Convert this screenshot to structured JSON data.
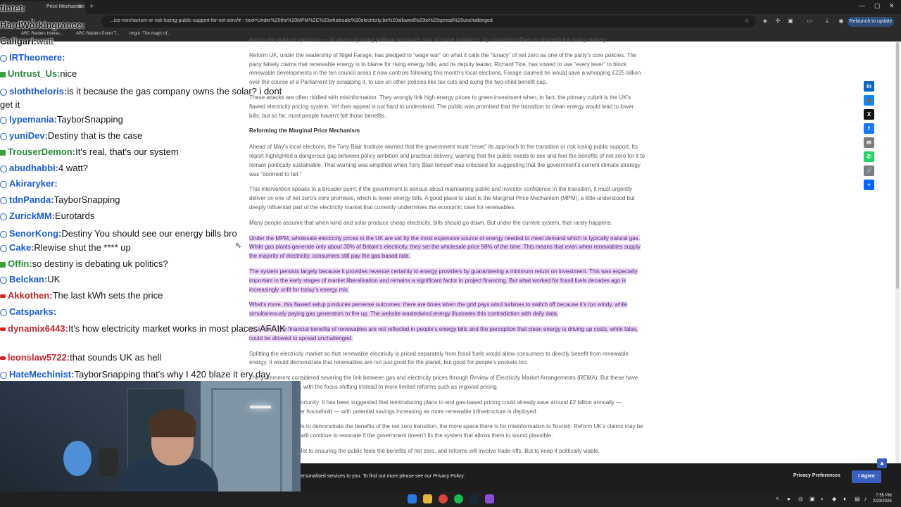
{
  "browser": {
    "tab_title": "Price Mechanism",
    "url": "...ice-mechanism-or-risk-losing-public-support-for-net-zero/#:~:text=Under%20the%20MPM%2C%20wholesale%20electricity,be%20allowed%20to%20spread%20unchallenged",
    "relaunch_label": "Relaunch to update",
    "bookmarks": [
      "ARC Raiders Interac...",
      "ARC Raiders Event T...",
      "Imgur: The magic of..."
    ]
  },
  "article": {
    "paragraphs_top": [
      "across the political spectrum — all driven by rising political pressures and, in some instances, by concerted efforts to discredit the policy entirely.",
      "Reform UK, under the leadership of Nigel Farage, has pledged to “wage war” on what it calls the “lunacy” of net zero as one of the party’s core policies. The party falsely claims that renewable energy is to blame for rising energy bills, and its deputy leader, Richard Tice, has vowed to use “every lever” to block renewable developments in the ten council areas it now controls following this month’s local elections. Farage claimed he would save a whopping £225 billion over the course of a Parliament by scrapping it, to use on other policies like tax cuts and axing the two-child benefit cap.",
      "These attacks are often riddled with misinformation. They wrongly link high energy prices to green investment when, in fact, the primary culprit is the UK’s flawed electricity pricing system. Yet their appeal is not hard to understand. The public was promised that the transition to clean energy would lead to lower bills, but so far, most people haven’t felt those benefits."
    ],
    "heading": "Reforming the Marginal Price Mechanism",
    "paragraphs_mid": [
      "Ahead of May’s local elections, the Tony Blair Institute warned that the government must “reset” its approach to the transition or risk losing public support. Its report highlighted a dangerous gap between policy ambition and practical delivery, warning that the public needs to see and feel the benefits of net zero for it to remain politically sustainable. That warning was amplified when Tony Blair himself was criticised for suggesting that the government’s current climate strategy was “doomed to fail.”",
      "This intervention speaks to a broader point: if the government is serious about maintaining public and investor confidence in the transition, it must urgently deliver on one of net zero’s core promises, which is lower energy bills. A good place to start is the Marginal Price Mechanism (MPM), a little-understood but deeply influential part of the electricity market that currently undermines the economic case for renewables.",
      "Many people assume that when wind and solar produce cheap electricity, bills should go down. But under the current system, that rarely happens."
    ],
    "highlighted": [
      "Under the MPM, wholesale electricity prices in the UK are set by the most expensive source of energy needed to meet demand which is typically natural gas. While gas plants generate only about 30% of Britain’s electricity, they set the wholesale price 98% of the time. This means that even when renewables supply the majority of electricity, consumers still pay the gas-based rate.",
      "The system persists largely because it provides revenue certainty to energy providers by guaranteeing a minimum return on investment. This was especially important in the early stages of market liberalisation and remains a significant factor in project financing. But what worked for fossil fuels decades ago is increasingly unfit for today’s energy mix.",
      "What’s more, this flawed setup produces perverse outcomes: there are times when the grid pays wind turbines to switch off because it’s too windy, while simultaneously paying gas generators to fire up. The website wastedwind.energy illustrates this contradiction with daily data.",
      "As a result, the financial benefits of renewables are not reflected in people’s energy bills and the perception that clean energy is driving up costs, while false, could be allowed to spread unchallenged."
    ],
    "paragraphs_bottom": [
      "Splitting the electricity market so that renewable electricity is priced separately from fossil fuels would allow consumers to directly benefit from renewable energy. It would demonstrate that renewables are not just good for the planet, but good for people’s pockets too.",
      "The government considered severing the link between gas and electricity prices through Review of Electricity Market Arrangements (REMA). But these have since been sidelined, with the focus shifting instead to more limited reforms such as regional pricing.",
      "This is a missed opportunity. It has been suggested that reintroducing plans to end gas-based pricing could already save around £2 billion annually — approximately £23 per household — with potential savings increasing as more renewable infrastructure is deployed.",
      "If the government fails to demonstrate the benefits of the net zero transition, the more space there is for misinformation to flourish. Reform UK’s claims may be misleading, but they will continue to resonate if the government doesn’t fix the system that allows them to sound plausible.",
      "There is no silver bullet to ensuring the public feels the benefits of net zero, and reforms will involve trade-offs. But to keep it politically viable,"
    ]
  },
  "share_buttons": [
    {
      "icon": "linkedin-icon",
      "glyph": "in",
      "color": "#0a66c2"
    },
    {
      "icon": "bluesky-icon",
      "glyph": "🦋",
      "color": "#1185fe"
    },
    {
      "icon": "x-icon",
      "glyph": "X",
      "color": "#111111"
    },
    {
      "icon": "facebook-icon",
      "glyph": "f",
      "color": "#1877f2"
    },
    {
      "icon": "email-icon",
      "glyph": "✉",
      "color": "#7c7c7c"
    },
    {
      "icon": "whatsapp-icon",
      "glyph": "✆",
      "color": "#25d366"
    },
    {
      "icon": "copy-link-icon",
      "glyph": "🔗",
      "color": "#7c7c7c"
    },
    {
      "icon": "share-plus-icon",
      "glyph": "+",
      "color": "#0166ff"
    }
  ],
  "chat": [
    {
      "user": "tintet:",
      "text": "",
      "badge": "none"
    },
    {
      "user": "HardWorkingrance:",
      "text": "",
      "badge": "none"
    },
    {
      "user": "Caligari:",
      "text": "watt",
      "badge": "none"
    },
    {
      "user": "IRTheomere:",
      "text": "",
      "badge": "b"
    },
    {
      "user": "Untrust_Us:",
      "text": "nice",
      "badge": "k"
    },
    {
      "user": "sloththeloris:",
      "text": "is it because the gas company owns the solar? i dont get it",
      "badge": "b"
    },
    {
      "user": "lypemania:",
      "text": "TayborSnapping",
      "badge": "b"
    },
    {
      "user": "yuniDev:",
      "text": "Destiny that is the case",
      "badge": "b"
    },
    {
      "user": "TrouserDemon:",
      "text": "It's real, that's our system",
      "badge": "k"
    },
    {
      "user": "abudhabbi:",
      "text": "4 watt?",
      "badge": "b"
    },
    {
      "user": "Akiraryker:",
      "text": "",
      "badge": "b"
    },
    {
      "user": "tdnPanda:",
      "text": "TayborSnapping",
      "badge": "b"
    },
    {
      "user": "ZurickMM:",
      "text": "Eurotards",
      "badge": "b"
    },
    {
      "user": "SenorKong:",
      "text": "Destiny You should see our energy bills bro",
      "badge": "b"
    },
    {
      "user": "Cake:",
      "text": "Rlewise shut the **** up",
      "badge": "b"
    },
    {
      "user": "Offin:",
      "text": "so destiny is debating uk politics?",
      "badge": "k"
    },
    {
      "user": "Belckan:",
      "text": "UK",
      "badge": "b"
    },
    {
      "user": "Akkothen:",
      "text": "The last kWh sets the price",
      "badge": "r"
    },
    {
      "user": "Catsparks:",
      "text": "",
      "badge": "b"
    },
    {
      "user": "dynamix6443:",
      "text": "It's how electricity market works in most places AFAIK",
      "badge": "r"
    },
    {
      "user": "leonslaw5722:",
      "text": "that sounds UK as hell",
      "badge": "r"
    },
    {
      "user": "HateMechinist:",
      "text": "TayborSnapping that's why I 420 blaze it ery day",
      "badge": "b"
    }
  ],
  "colors": {
    "user_blue": "#1c5bd6",
    "user_green": "#2c8a3a",
    "user_red": "#c2282f",
    "user_dark": "#161616"
  },
  "cookie_bar": {
    "text": "ersonalised services to you. To find out more please see our Privacy Policy.",
    "privacy_label": "Privacy Preferences",
    "agree_label": "I Agree"
  },
  "clock": {
    "time": "7:55 PM",
    "date": "2/23/2026"
  }
}
